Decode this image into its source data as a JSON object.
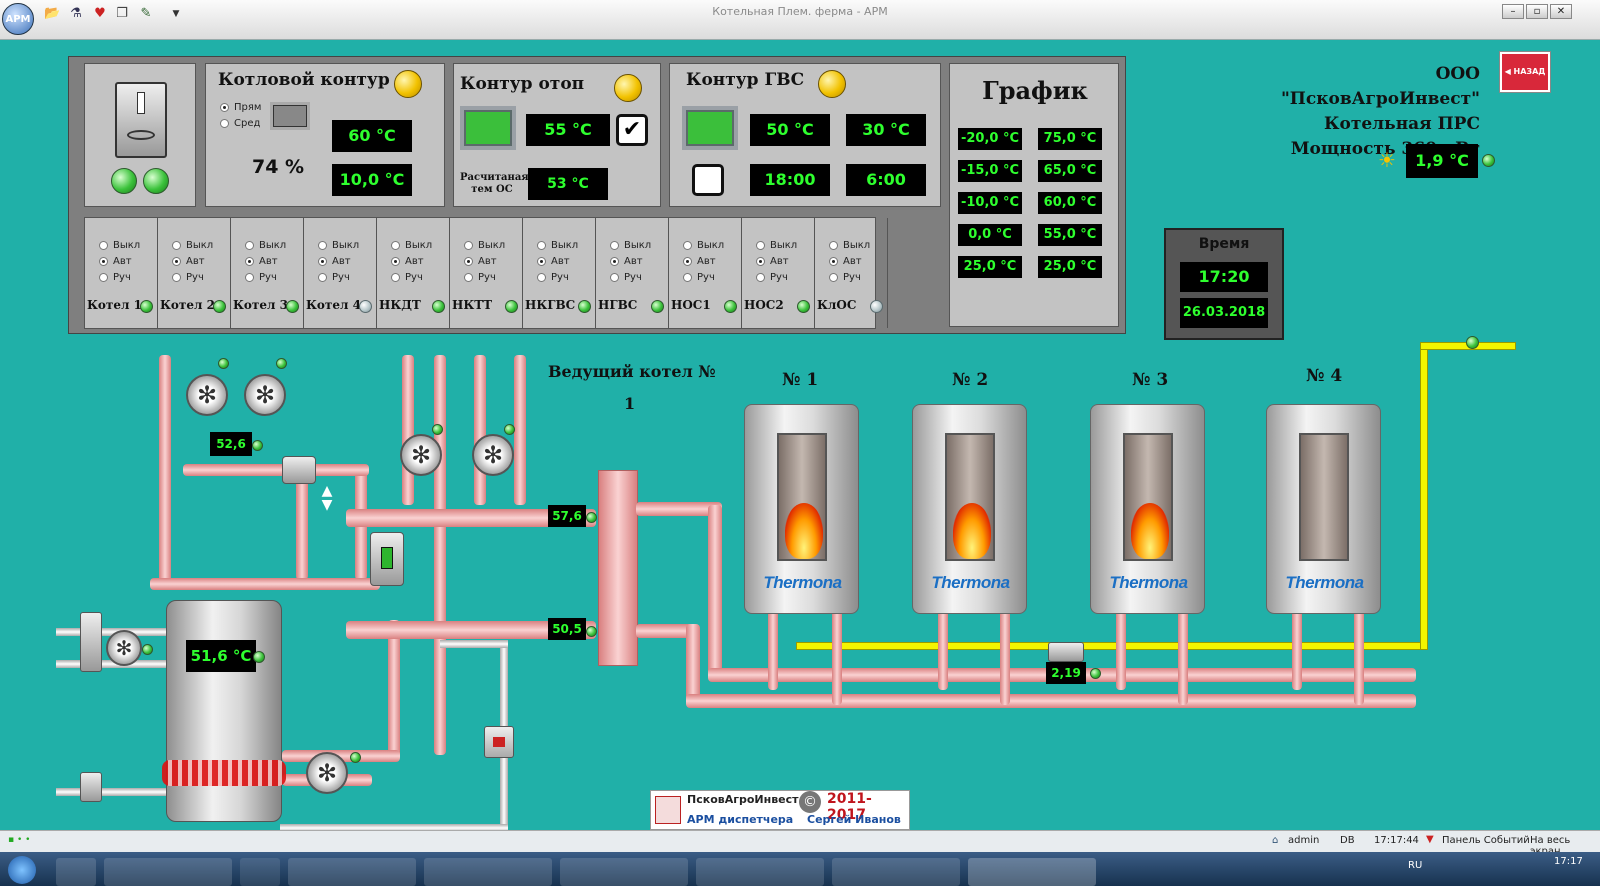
{
  "window": {
    "title": "Котельная Плем. ферма - АРМ",
    "app_logo": "АРМ",
    "buttons": [
      "–",
      "▫",
      "✕"
    ],
    "quick_icons": [
      "folder-icon",
      "flask-icon",
      "heart-icon",
      "copy-icon",
      "edit-icon",
      "dropdown-icon"
    ]
  },
  "kotlovoy": {
    "title": "Котловой контур",
    "opt1": "Прям",
    "opt2": "Сред",
    "selected": "Прям",
    "percent": "74 %",
    "t1": "60 °C",
    "t2": "10,0 °C"
  },
  "otop": {
    "title": "Контур отоп",
    "temp": "55 °C",
    "calc_label_1": "Расчитаная",
    "calc_label_2": "тем ОС",
    "calc_temp": "53 °C",
    "checked": true
  },
  "gvs": {
    "title": "Контур ГВС",
    "t1": "50 °C",
    "t2": "30 °C",
    "time1": "18:00",
    "time2": "6:00"
  },
  "grafik": {
    "title": "График",
    "rows": [
      [
        "-20,0 °C",
        "75,0 °C"
      ],
      [
        "-15,0 °C",
        "65,0 °C"
      ],
      [
        "-10,0 °C",
        "60,0 °C"
      ],
      [
        "0,0 °C",
        "55,0 °C"
      ],
      [
        "25,0 °C",
        "25,0 °C"
      ]
    ]
  },
  "modes": {
    "off": "Выкл",
    "auto": "Авт",
    "manual": "Руч"
  },
  "units": [
    {
      "name": "Котел 1",
      "mode": "auto",
      "led": "green"
    },
    {
      "name": "Котел 2",
      "mode": "auto",
      "led": "green"
    },
    {
      "name": "Котел 3",
      "mode": "auto",
      "led": "green"
    },
    {
      "name": "Котел 4",
      "mode": "auto",
      "led": "grey"
    },
    {
      "name": "НКДТ",
      "mode": "auto",
      "led": "green"
    },
    {
      "name": "НКТТ",
      "mode": "auto",
      "led": "green"
    },
    {
      "name": "НКГВС",
      "mode": "auto",
      "led": "green"
    },
    {
      "name": "НГВС",
      "mode": "auto",
      "led": "green"
    },
    {
      "name": "НОС1",
      "mode": "auto",
      "led": "green"
    },
    {
      "name": "НОС2",
      "mode": "auto",
      "led": "green"
    },
    {
      "name": "КлОС",
      "mode": "auto",
      "led": "grey"
    }
  ],
  "company": {
    "line1": "ООО \"ПсковАгроИнвест\"",
    "line2": "Котельная ПРС",
    "line3": "Мощность 360 кВт",
    "back": "НАЗАД",
    "outdoor_temp": "1,9 °C"
  },
  "clock": {
    "label": "Время",
    "time": "17:20",
    "date": "26.03.2018"
  },
  "scheme": {
    "leading_label": "Ведущий котел №",
    "leading_value": "1",
    "supply_temp": "57,6",
    "return_temp": "50,5",
    "pump_temp": "52,6",
    "tank_temp": "51,6 °C",
    "pressure": "2,19",
    "boilers": [
      {
        "num": "№ 1",
        "burning": true
      },
      {
        "num": "№ 2",
        "burning": true
      },
      {
        "num": "№ 3",
        "burning": true
      },
      {
        "num": "№ 4",
        "burning": false
      }
    ],
    "brand": "Thermona"
  },
  "footer_logo": {
    "company": "ПсковАгроИнвест",
    "years": "2011-2017",
    "product": "АРМ диспетчера",
    "author": "Сергей Иванов"
  },
  "status": {
    "user": "admin",
    "db": "DB",
    "time": "17:17:44",
    "events": "Панель Событий",
    "full": "На весь экран"
  },
  "taskbar": {
    "clock": "17:17",
    "lang": "RU"
  }
}
